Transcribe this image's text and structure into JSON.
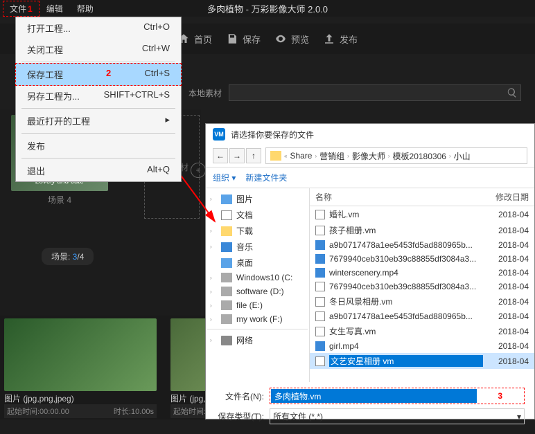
{
  "menubar": {
    "file": "文件",
    "edit": "编辑",
    "help": "帮助"
  },
  "title": "多肉植物 - 万彩影像大师 2.0.0",
  "toolbar": {
    "home": "首页",
    "save": "保存",
    "preview": "预览",
    "publish": "发布"
  },
  "dropdown": {
    "open": "打开工程...",
    "open_key": "Ctrl+O",
    "close": "关闭工程",
    "close_key": "Ctrl+W",
    "save": "保存工程",
    "save_key": "Ctrl+S",
    "saveas": "另存工程为...",
    "saveas_key": "SHIFT+CTRL+S",
    "recent": "最近打开的工程",
    "publish": "发布",
    "exit": "退出",
    "exit_key": "Alt+Q"
  },
  "markers": {
    "m1": "1",
    "m2": "2",
    "m3": "3"
  },
  "search_section": {
    "local": "本地素材"
  },
  "scenes": {
    "thumb_caption": "Lovely and cute",
    "scene_label": "场景 4",
    "add_text": "添加素材",
    "counter_label": "场景: ",
    "cur": "3",
    "total": "/4"
  },
  "photostrip": {
    "label": "图片  (jpg,png,jpeg)",
    "start": "起始时间:00:00.00",
    "dur": "时长:10.00s"
  },
  "dialog": {
    "title": "请选择你要保存的文件",
    "crumbs": [
      "Share",
      "营销组",
      "影像大师",
      "模板20180306",
      "小山"
    ],
    "organize": "组织",
    "newfolder": "新建文件夹",
    "tree": [
      {
        "label": "图片",
        "icon": "pic-c",
        "expand": "›"
      },
      {
        "label": "文档",
        "icon": "doc-c",
        "expand": "›"
      },
      {
        "label": "下载",
        "icon": "folder-c",
        "expand": "›"
      },
      {
        "label": "音乐",
        "icon": "music-c",
        "expand": "›"
      },
      {
        "label": "桌面",
        "icon": "pic-c",
        "expand": ""
      },
      {
        "label": "Windows10 (C:",
        "icon": "disk-c",
        "expand": "›"
      },
      {
        "label": "software (D:)",
        "icon": "disk-c",
        "expand": "›"
      },
      {
        "label": "file (E:)",
        "icon": "disk-c",
        "expand": "›"
      },
      {
        "label": "my work (F:)",
        "icon": "disk-c",
        "expand": "›"
      },
      {
        "label": "网络",
        "icon": "drive-c",
        "expand": "›"
      }
    ],
    "col_name": "名称",
    "col_date": "修改日期",
    "files": [
      {
        "name": "婚礼.vm",
        "date": "2018-04",
        "icon": "doc-c"
      },
      {
        "name": "孩子相册.vm",
        "date": "2018-04",
        "icon": "doc-c"
      },
      {
        "name": "a9b0717478a1ee5453fd5ad880965b...",
        "date": "2018-04",
        "icon": "vid-c"
      },
      {
        "name": "7679940ceb310eb39c88855df3084a3...",
        "date": "2018-04",
        "icon": "vid-c"
      },
      {
        "name": "winterscenery.mp4",
        "date": "2018-04",
        "icon": "vid-c"
      },
      {
        "name": "7679940ceb310eb39c88855df3084a3...",
        "date": "2018-04",
        "icon": "doc-c"
      },
      {
        "name": "冬日风景相册.vm",
        "date": "2018-04",
        "icon": "doc-c"
      },
      {
        "name": "a9b0717478a1ee5453fd5ad880965b...",
        "date": "2018-04",
        "icon": "doc-c"
      },
      {
        "name": "女生写真.vm",
        "date": "2018-04",
        "icon": "doc-c"
      },
      {
        "name": "girl.mp4",
        "date": "2018-04",
        "icon": "vid-c"
      },
      {
        "name": "文艺安星相册 vm",
        "date": "2018-04",
        "icon": "doc-c",
        "sel": true
      }
    ],
    "filename_label": "文件名(N):",
    "filename_value": "多肉植物.vm",
    "filetype_label": "保存类型(T):",
    "filetype_value": "所有文件 (*.*)"
  }
}
